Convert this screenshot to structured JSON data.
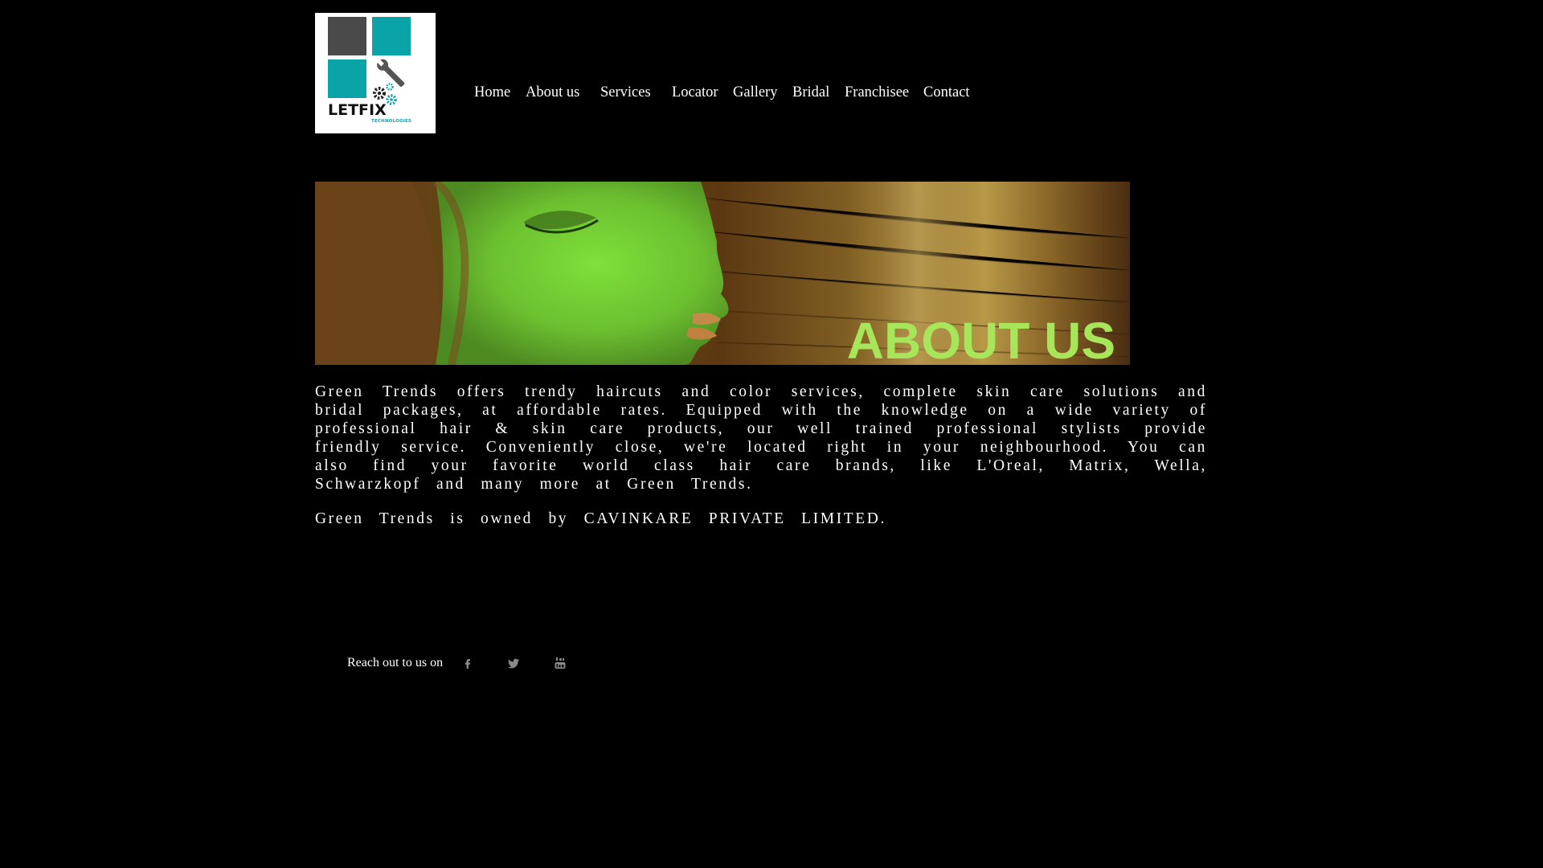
{
  "logo": {
    "word": "LETFIX",
    "sub": "TECHNOLOGIES",
    "colors": {
      "gray": "#4a4a4a",
      "teal": "#0aa3a8"
    }
  },
  "nav": {
    "items": [
      {
        "label": "Home"
      },
      {
        "label": "About us"
      },
      {
        "label": "Services"
      },
      {
        "label": "Locator"
      },
      {
        "label": "Gallery"
      },
      {
        "label": "Bridal"
      },
      {
        "label": "Franchisee"
      },
      {
        "label": "Contact"
      }
    ]
  },
  "banner": {
    "title": "ABOUT US",
    "title_color": "#a7e55a"
  },
  "content": {
    "paragraphs": [
      "Green Trends offers trendy haircuts and color services, complete skin care solutions and bridal packages, at affordable rates. Equipped with the knowledge on a wide variety of professional hair & skin care products, our well trained professional stylists provide friendly service. Conveniently close, we're located right in your neighbourhood. You can also find your favorite world class hair care brands, like L'Oreal, Matrix, Wella, Schwarzkopf and many more at Green Trends.",
      "Green Trends is owned by CAVINKARE PRIVATE LIMITED."
    ]
  },
  "footer": {
    "reach_label": "Reach out to us on",
    "icons": [
      "facebook-icon",
      "twitter-icon",
      "youtube-icon"
    ],
    "icon_color": "#8a8a8a"
  }
}
